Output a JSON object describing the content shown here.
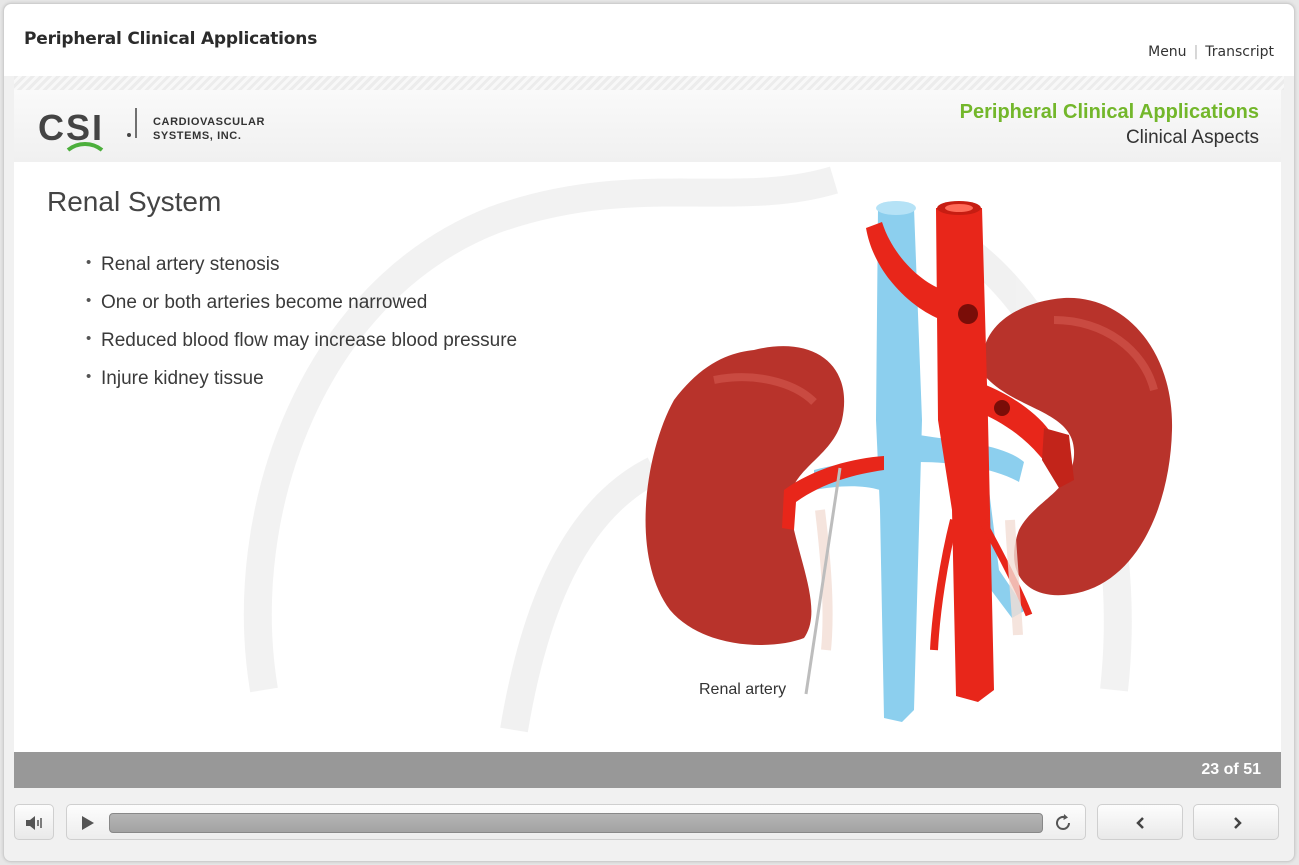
{
  "window": {
    "course_title": "Peripheral Clinical Applications"
  },
  "top_nav": {
    "menu": "Menu",
    "transcript": "Transcript"
  },
  "header": {
    "logo": {
      "mark": "CSI",
      "line1": "CARDIOVASCULAR",
      "line2": "SYSTEMS, INC."
    },
    "title": "Peripheral Clinical Applications",
    "subtitle": "Clinical Aspects"
  },
  "slide": {
    "heading": "Renal System",
    "bullets": [
      "Renal artery stenosis",
      "One or both arteries become narrowed",
      "Reduced blood flow may increase blood pressure",
      "Injure kidney tissue"
    ],
    "callout": "Renal artery"
  },
  "footer": {
    "page_indicator": "23 of 51"
  },
  "controls": {
    "volume_icon": "speaker-icon",
    "play_icon": "play-icon",
    "replay_icon": "replay-icon",
    "prev_icon": "chevron-left-icon",
    "next_icon": "chevron-right-icon",
    "progress": 0
  },
  "colors": {
    "accent": "#73b72b",
    "artery": "#e8261a",
    "vein": "#8ccfee",
    "kidney": "#b8332b",
    "footer": "#989898"
  }
}
